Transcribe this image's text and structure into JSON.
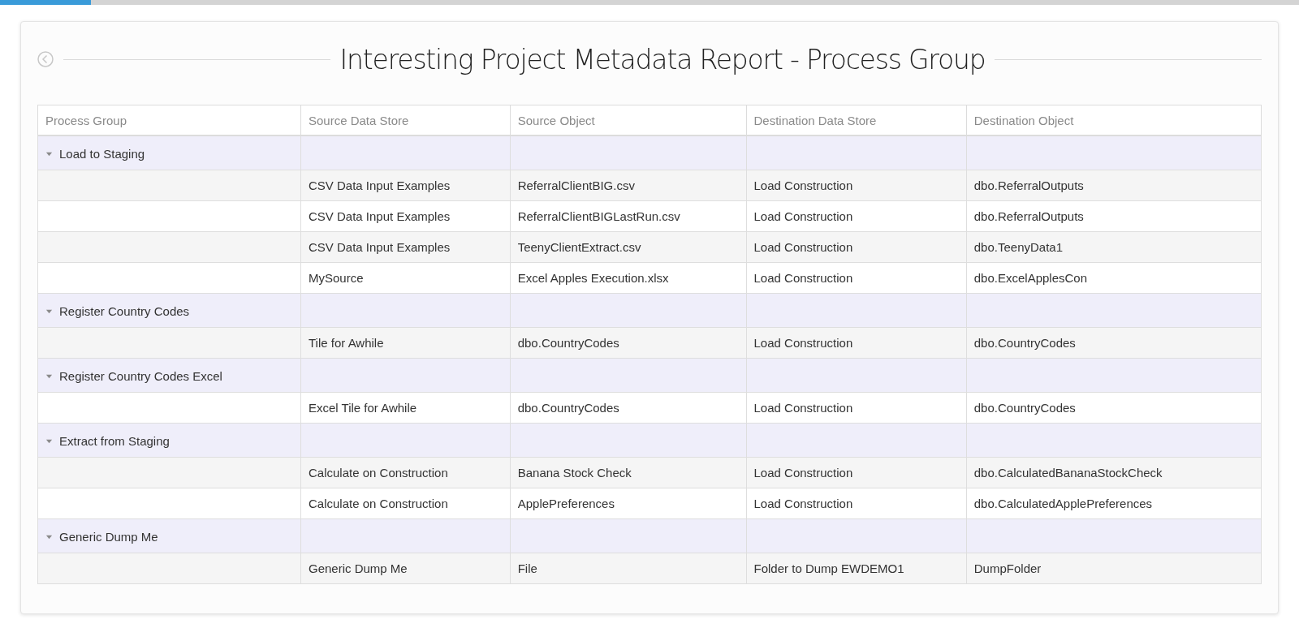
{
  "progress": {
    "level": 0.07
  },
  "title": "Interesting Project Metadata Report - Process Group",
  "table": {
    "columns": [
      "Process Group",
      "Source Data Store",
      "Source Object",
      "Destination Data Store",
      "Destination Object"
    ],
    "groups": [
      {
        "name": "Load to Staging",
        "expanded": true,
        "rows": [
          [
            "CSV Data Input Examples",
            "ReferralClientBIG.csv",
            "Load Construction",
            "dbo.ReferralOutputs"
          ],
          [
            "CSV Data Input Examples",
            "ReferralClientBIGLastRun.csv",
            "Load Construction",
            "dbo.ReferralOutputs"
          ],
          [
            "CSV Data Input Examples",
            "TeenyClientExtract.csv",
            "Load Construction",
            "dbo.TeenyData1"
          ],
          [
            "MySource",
            "Excel Apples Execution.xlsx",
            "Load Construction",
            "dbo.ExcelApplesCon"
          ]
        ]
      },
      {
        "name": "Register Country Codes",
        "expanded": true,
        "rows": [
          [
            "Tile for Awhile",
            "dbo.CountryCodes",
            "Load Construction",
            "dbo.CountryCodes"
          ]
        ]
      },
      {
        "name": "Register Country Codes Excel",
        "expanded": true,
        "rows": [
          [
            "Excel Tile for Awhile",
            "dbo.CountryCodes",
            "Load Construction",
            "dbo.CountryCodes"
          ]
        ]
      },
      {
        "name": "Extract from Staging",
        "expanded": true,
        "rows": [
          [
            "Calculate on Construction",
            "Banana Stock Check",
            "Load Construction",
            "dbo.CalculatedBananaStockCheck"
          ],
          [
            "Calculate on Construction",
            "ApplePreferences",
            "Load Construction",
            "dbo.CalculatedApplePreferences"
          ]
        ]
      },
      {
        "name": "Generic Dump Me",
        "expanded": true,
        "rows": [
          [
            "Generic Dump Me",
            "File",
            "Folder to Dump EWDEMO1",
            "DumpFolder"
          ]
        ]
      }
    ]
  }
}
